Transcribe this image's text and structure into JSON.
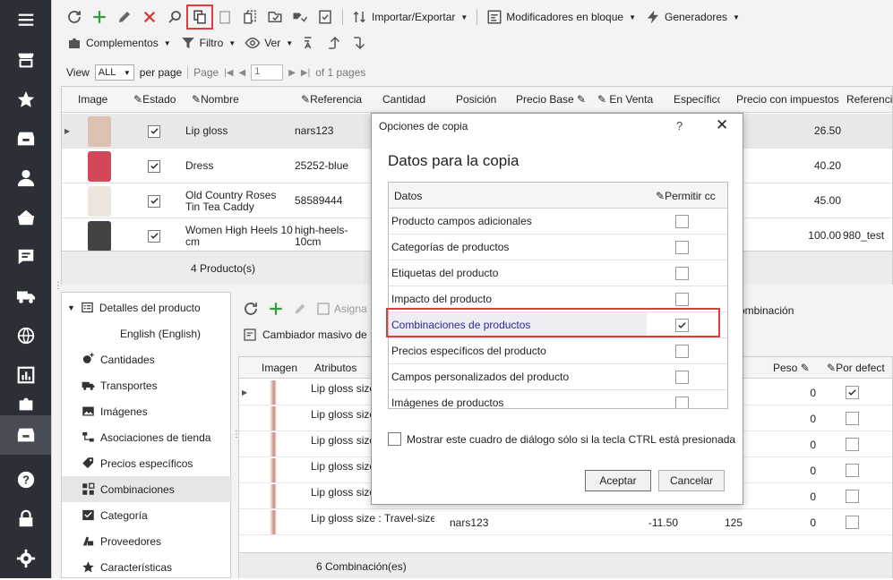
{
  "toolbar1": {
    "import_export": "Importar/Exportar",
    "bulk_modifiers": "Modificadores en bloque",
    "generators": "Generadores"
  },
  "toolbar2": {
    "addons": "Complementos",
    "filter": "Filtro",
    "view": "Ver"
  },
  "pager": {
    "view_label": "View",
    "view_value": "ALL",
    "per_page": "per page",
    "page_label": "Page",
    "page_value": "1",
    "of_pages": "of 1 pages"
  },
  "grid": {
    "columns": [
      "Imagen",
      "Estado",
      "Nombre",
      "Referencia",
      "Cantidad",
      "Posición",
      "Precio Base",
      "En Venta",
      "Específico",
      "Precio con impuestos",
      "Referencia"
    ],
    "rows": [
      {
        "name": "Lip gloss",
        "ref": "nars123",
        "price_tax": "26.50",
        "ref2": "",
        "checked": true
      },
      {
        "name": "Dress",
        "ref": "25252-blue",
        "price_tax": "40.20",
        "ref2": "",
        "checked": true
      },
      {
        "name": "Old Country Roses Tin Tea Caddy",
        "ref": "58589444",
        "price_tax": "45.00",
        "ref2": "",
        "checked": true
      },
      {
        "name": "Women High Heels 10 cm",
        "ref": "high-heels-10cm",
        "price_tax": "100.00",
        "ref2": "980_test",
        "checked": true
      }
    ],
    "footer": "4 Producto(s)"
  },
  "details": {
    "header": "Detalles del producto",
    "language": "English (English)",
    "items": [
      {
        "label": "Cantidades",
        "icon": "quantities-icon"
      },
      {
        "label": "Transportes",
        "icon": "truck-icon"
      },
      {
        "label": "Imágenes",
        "icon": "images-icon"
      },
      {
        "label": "Asociaciones de tienda",
        "icon": "store-assoc-icon"
      },
      {
        "label": "Precios específicos",
        "icon": "tag-icon"
      },
      {
        "label": "Combinaciones",
        "icon": "combinations-icon"
      },
      {
        "label": "Categoría",
        "icon": "category-icon"
      },
      {
        "label": "Proveedores",
        "icon": "suppliers-icon"
      },
      {
        "label": "Características",
        "icon": "star-icon"
      }
    ]
  },
  "comb": {
    "assign": "Asigna",
    "combination": "ombinación",
    "mass_changer": "Cambiador masivo de",
    "columns": [
      "Imagen",
      "Atributos",
      "Peso",
      "Por defect"
    ],
    "rows": [
      {
        "attr": "Lip gloss size",
        "ref": "",
        "price": "",
        "qty": "",
        "weight": "0",
        "default": true
      },
      {
        "attr": "Lip gloss size",
        "ref": "",
        "price": "",
        "qty": "",
        "weight": "0",
        "default": false
      },
      {
        "attr": "Lip gloss size",
        "ref": "",
        "price": "",
        "qty": "",
        "weight": "0",
        "default": false
      },
      {
        "attr": "Lip gloss size",
        "ref": "",
        "price": "",
        "qty": "",
        "weight": "0",
        "default": false
      },
      {
        "attr": "Lip gloss size",
        "ref": "",
        "price": "",
        "qty": "",
        "weight": "0",
        "default": false
      },
      {
        "attr": "Lip gloss size : Travel-size,",
        "ref": "nars123",
        "price": "-11.50",
        "qty": "125",
        "weight": "0",
        "default": false
      }
    ],
    "footer": "6 Combinación(es)"
  },
  "dialog": {
    "title": "Opciones de copia",
    "help": "?",
    "heading": "Datos para la copia",
    "col_data": "Datos",
    "col_allow": "Permitir cc",
    "items": [
      {
        "label": "Producto campos adicionales",
        "checked": false
      },
      {
        "label": "Categorías de productos",
        "checked": false
      },
      {
        "label": "Etiquetas del producto",
        "checked": false
      },
      {
        "label": "Impacto del producto",
        "checked": false
      },
      {
        "label": "Combinaciones de productos",
        "checked": true
      },
      {
        "label": "Precios específicos del producto",
        "checked": false
      },
      {
        "label": "Campos personalizados del producto",
        "checked": false
      },
      {
        "label": "Imágenes de productos",
        "checked": false
      }
    ],
    "ctrl_label": "Mostrar este cuadro de diálogo sólo si la tecla CTRL está presionada",
    "accept": "Aceptar",
    "cancel": "Cancelar"
  },
  "colors": {
    "accent_green": "#2e9e3e",
    "accent_red": "#d93232",
    "highlight": "#e23b3b",
    "sidebar": "#2b2f36"
  }
}
